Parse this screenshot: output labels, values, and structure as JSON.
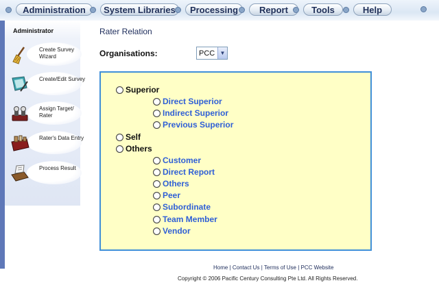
{
  "nav": {
    "items": [
      {
        "label": "Administration"
      },
      {
        "label": "System Libraries"
      },
      {
        "label": "Processing"
      },
      {
        "label": "Report"
      },
      {
        "label": "Tools"
      },
      {
        "label": "Help"
      }
    ]
  },
  "sidebar": {
    "title": "Administrator",
    "items": [
      {
        "label": "Create Survey Wizard",
        "icon": "broom-icon"
      },
      {
        "label": "Create/Edit Survey",
        "icon": "notepad-icon"
      },
      {
        "label": "Assign Target/ Rater",
        "icon": "people-icon"
      },
      {
        "label": "Rater's Data Entry",
        "icon": "toolbox-icon"
      },
      {
        "label": "Process Result",
        "icon": "printer-icon"
      }
    ]
  },
  "main": {
    "title": "Rater Relation",
    "org_label": "Organisations:",
    "org_value": "PCC",
    "options": {
      "superior": "Superior",
      "superior_children": [
        "Direct Superior",
        "Indirect Superior",
        "Previous Superior"
      ],
      "self": "Self",
      "others": "Others",
      "others_children": [
        "Customer",
        "Direct Report",
        "Others",
        "Peer",
        "Subordinate",
        "Team Member",
        "Vendor"
      ]
    }
  },
  "footer": {
    "links": [
      "Home",
      "Contact Us",
      "Terms of Use",
      "PCC Website"
    ],
    "copyright": "Copyright © 2006 Pacific Century Consulting Pte Ltd. All Rights Reserved."
  },
  "colors": {
    "box_bg": "#ffffc6",
    "box_border": "#3f8fd8",
    "sub_option_text": "#2f5fd6",
    "sidebar_stripe": "#5f78b8"
  }
}
